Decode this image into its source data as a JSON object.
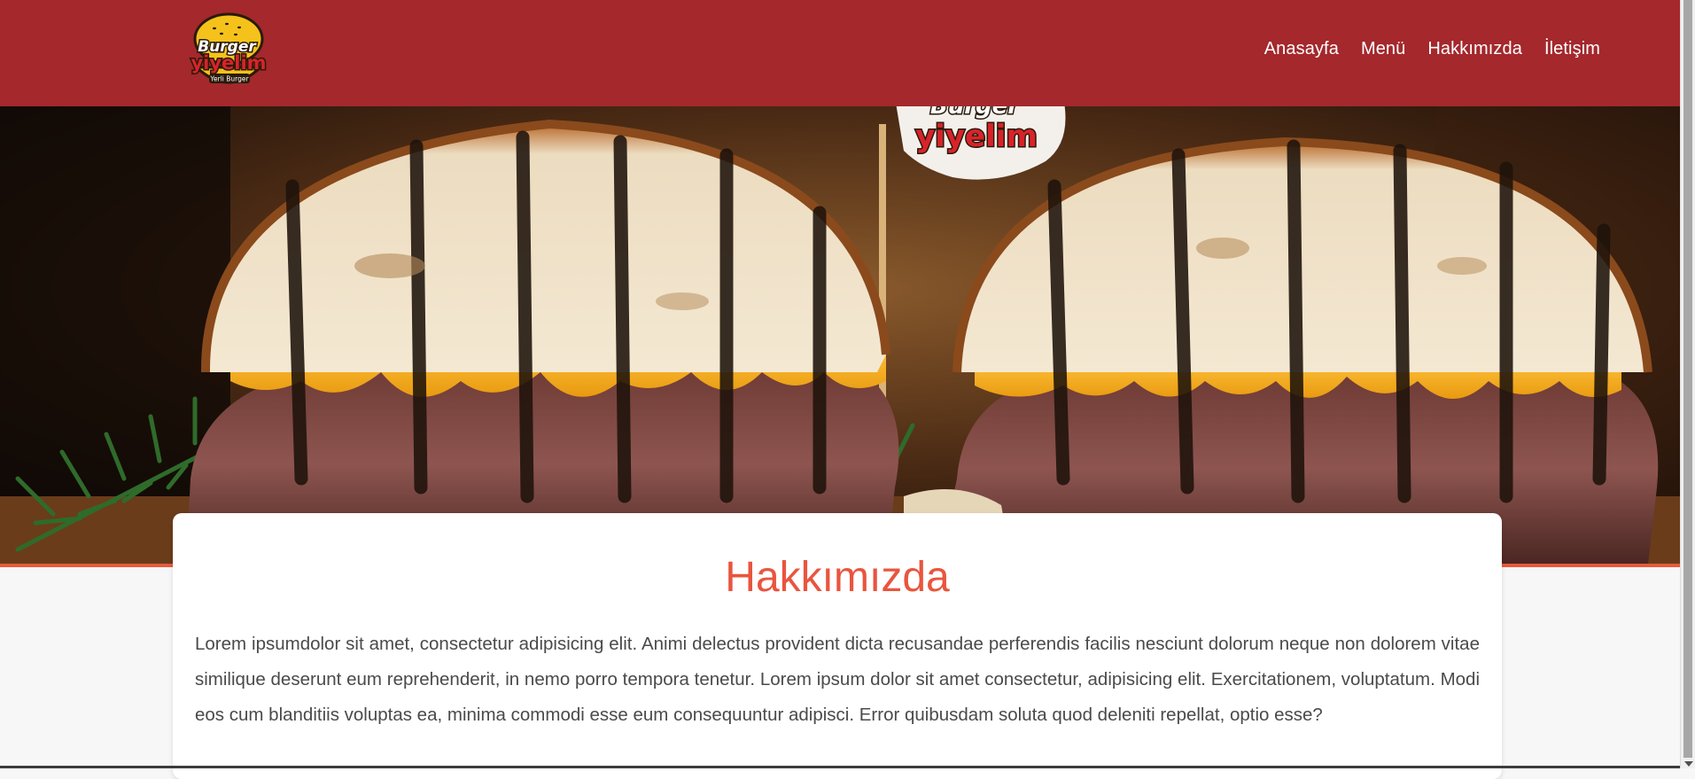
{
  "brand": {
    "line1": "Burger",
    "line2": "yiyelim",
    "tagline": "Yerli Burger",
    "colors": {
      "header_bg": "#a4282c",
      "accent": "#e9553e",
      "logo_yellow": "#f5c21b",
      "logo_red": "#d8232a"
    }
  },
  "nav": {
    "items": [
      {
        "label": "Anasayfa"
      },
      {
        "label": "Menü"
      },
      {
        "label": "Hakkımızda"
      },
      {
        "label": "İletişim"
      }
    ]
  },
  "hero": {
    "image": "burger-hero-photo",
    "flag_text_line1": "Burger",
    "flag_text_line2": "yiyelim"
  },
  "about": {
    "title": "Hakkımızda",
    "body": "Lorem ipsumdolor sit amet, consectetur adipisicing elit. Animi delectus provident dicta recusandae perferendis facilis nesciunt dolorum neque non dolorem vitae similique deserunt eum reprehenderit, in nemo porro tempora tenetur. Lorem ipsum dolor sit amet consectetur, adipisicing elit. Exercitationem, voluptatum. Modi eos cum blanditiis voluptas ea, minima commodi esse eum consequuntur adipisci. Error quibusdam soluta quod deleniti repellat, optio esse?"
  }
}
